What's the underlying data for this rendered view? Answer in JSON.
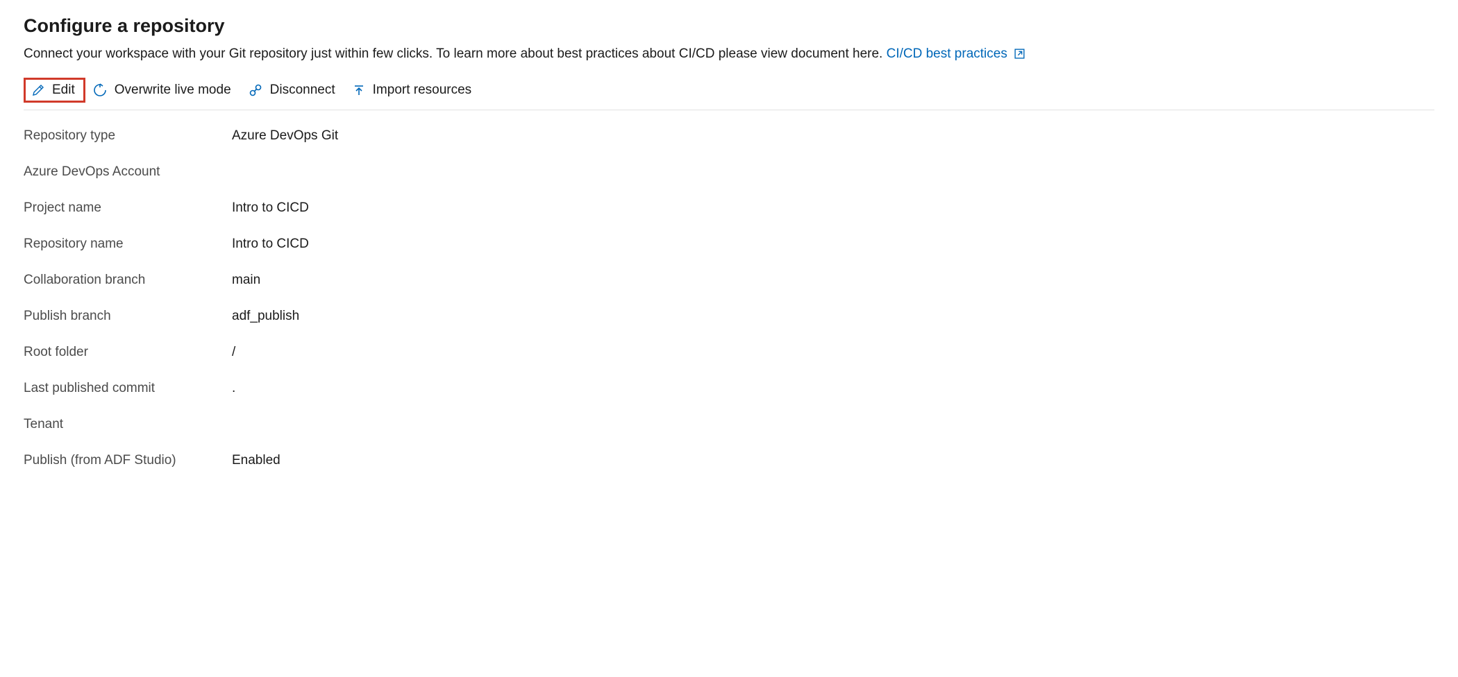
{
  "header": {
    "title": "Configure a repository",
    "subtitle_text": "Connect your workspace with your Git repository just within few clicks. To learn more about best practices about CI/CD please view document here.",
    "link_text": "CI/CD best practices"
  },
  "toolbar": {
    "edit_label": "Edit",
    "overwrite_label": "Overwrite live mode",
    "disconnect_label": "Disconnect",
    "import_label": "Import resources"
  },
  "details": {
    "rows": [
      {
        "label": "Repository type",
        "value": "Azure DevOps Git"
      },
      {
        "label": "Azure DevOps Account",
        "value": ""
      },
      {
        "label": "Project name",
        "value": "Intro to CICD"
      },
      {
        "label": "Repository name",
        "value": "Intro to CICD"
      },
      {
        "label": "Collaboration branch",
        "value": "main"
      },
      {
        "label": "Publish branch",
        "value": "adf_publish"
      },
      {
        "label": "Root folder",
        "value": "/"
      },
      {
        "label": "Last published commit",
        "value": "."
      },
      {
        "label": "Tenant",
        "value": ""
      },
      {
        "label": "Publish (from ADF Studio)",
        "value": "Enabled"
      }
    ]
  }
}
